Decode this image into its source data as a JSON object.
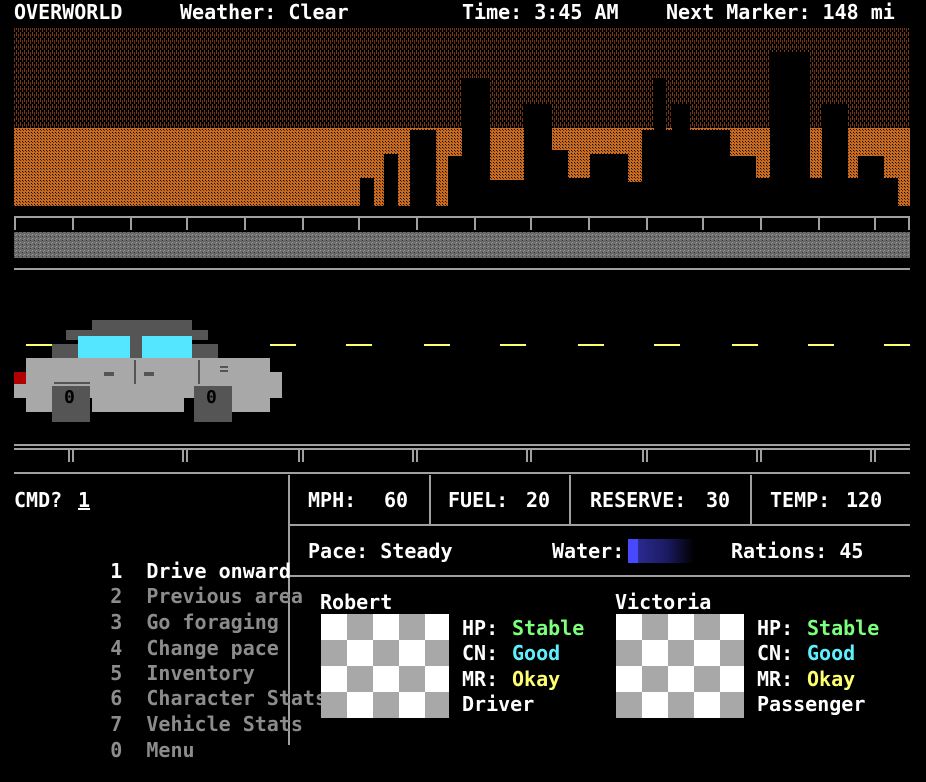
{
  "header": {
    "area": "OVERWORLD",
    "weather": "Weather: Clear",
    "time": "Time: 3:45 AM",
    "next_marker": "Next Marker: 148 mi"
  },
  "car": {
    "wheel_left": "0",
    "wheel_right": "0"
  },
  "command": {
    "prompt": "CMD?",
    "value": "1"
  },
  "menu": [
    {
      "num": "1",
      "label": "Drive onward",
      "enabled": true
    },
    {
      "num": "2",
      "label": "Previous area",
      "enabled": false
    },
    {
      "num": "3",
      "label": "Go foraging",
      "enabled": false
    },
    {
      "num": "4",
      "label": "Change pace",
      "enabled": false
    },
    {
      "num": "5",
      "label": "Inventory",
      "enabled": false
    },
    {
      "num": "6",
      "label": "Character Stats",
      "enabled": false
    },
    {
      "num": "7",
      "label": "Vehicle Stats",
      "enabled": false
    },
    {
      "num": "0",
      "label": "Menu",
      "enabled": false
    }
  ],
  "vehicle": {
    "mph_label": "MPH:",
    "mph": "60",
    "fuel_label": "FUEL:",
    "fuel": "20",
    "reserve_label": "RESERVE:",
    "reserve": "30",
    "temp_label": "TEMP:",
    "temp": "120"
  },
  "status": {
    "pace": "Pace: Steady",
    "water_label": "Water:",
    "water_level": 0.15,
    "rations": "Rations: 45"
  },
  "party": [
    {
      "name": "Robert",
      "hp_label": "HP:",
      "hp": "Stable",
      "cn_label": "CN:",
      "cn": "Good",
      "mr_label": "MR:",
      "mr": "Okay",
      "role": "Driver"
    },
    {
      "name": "Victoria",
      "hp_label": "HP:",
      "hp": "Stable",
      "cn_label": "CN:",
      "cn": "Good",
      "mr_label": "MR:",
      "mr": "Okay",
      "role": "Passenger"
    }
  ],
  "colors": {
    "sky_orange": "#c8641e",
    "window_cyan": "#55e6ff",
    "hp_green": "#7cff7c",
    "cn_cyan": "#5ff0ff",
    "mr_yellow": "#ffff70",
    "water_blue": "#4040ff"
  }
}
